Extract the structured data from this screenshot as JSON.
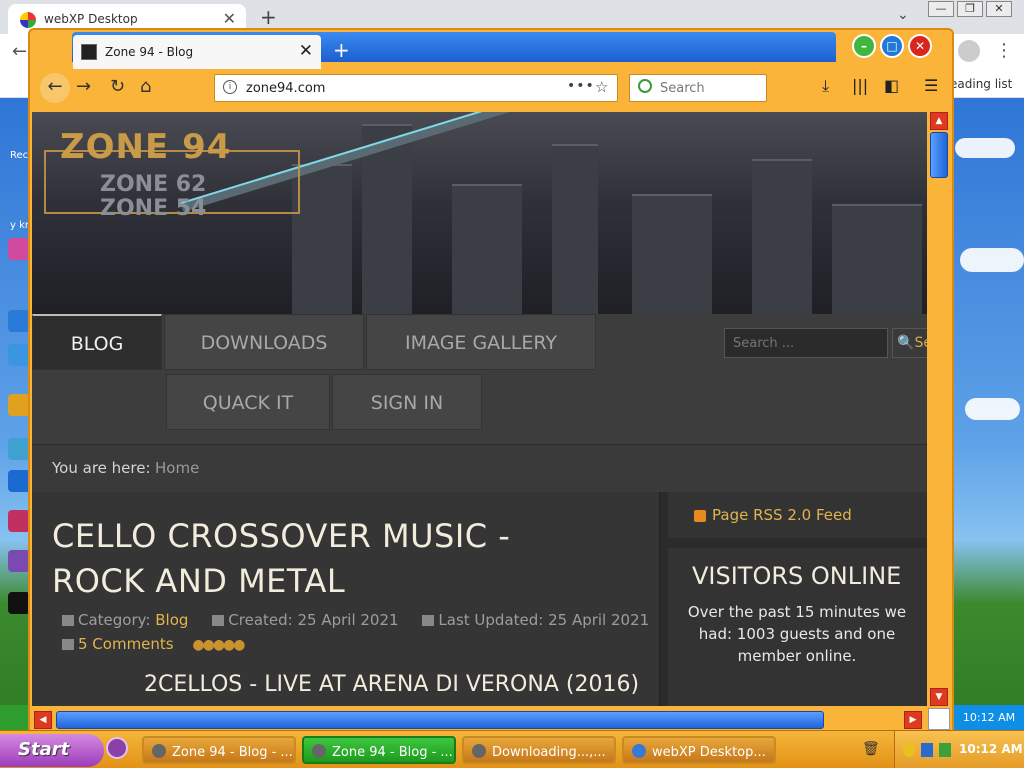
{
  "host": {
    "tab_title": "webXP Desktop",
    "reading_list": "eading list"
  },
  "firefox": {
    "tab_title": "Zone 94 - Blog",
    "url": "zone94.com",
    "search_placeholder": "Search"
  },
  "site": {
    "logo_main": "ZONE 94",
    "logo_sub1": "ZONE 62",
    "logo_sub2": "ZONE 54",
    "menu": [
      {
        "label": "BLOG",
        "active": true
      },
      {
        "label": "DOWNLOADS"
      },
      {
        "label": "IMAGE GALLERY"
      },
      {
        "label": "QUACK IT"
      },
      {
        "label": "SIGN IN"
      }
    ],
    "search_placeholder": "Search ...",
    "search_button": "Search",
    "breadcrumb_label": "You are here:",
    "breadcrumb_home": "Home",
    "article": {
      "title": "CELLO CROSSOVER MUSIC - ROCK AND METAL",
      "category_label": "Category:",
      "category_link": "Blog",
      "created": "Created: 25 April 2021",
      "updated": "Last Updated: 25 April 2021",
      "comments": "5 Comments",
      "video_title": "2CELLOS - LIVE AT ARENA DI VERONA (2016)"
    },
    "sidebar": {
      "rss": "Page RSS 2.0 Feed",
      "visitors_title": "VISITORS ONLINE",
      "visitors_text": "Over the past 15 minutes we had: 1003 guests and one member online."
    }
  },
  "desktop": {
    "labels": [
      "Rec",
      "y kn"
    ]
  },
  "taskbar": {
    "start": "Start",
    "tasks": [
      {
        "label": "Zone 94 - Blog - ..."
      },
      {
        "label": "Zone 94 - Blog - ...",
        "active": true
      },
      {
        "label": "Downloading...,..."
      },
      {
        "label": "webXP Desktop..."
      }
    ],
    "clock": "10:12 AM",
    "inner_clock": "10:12 AM"
  }
}
